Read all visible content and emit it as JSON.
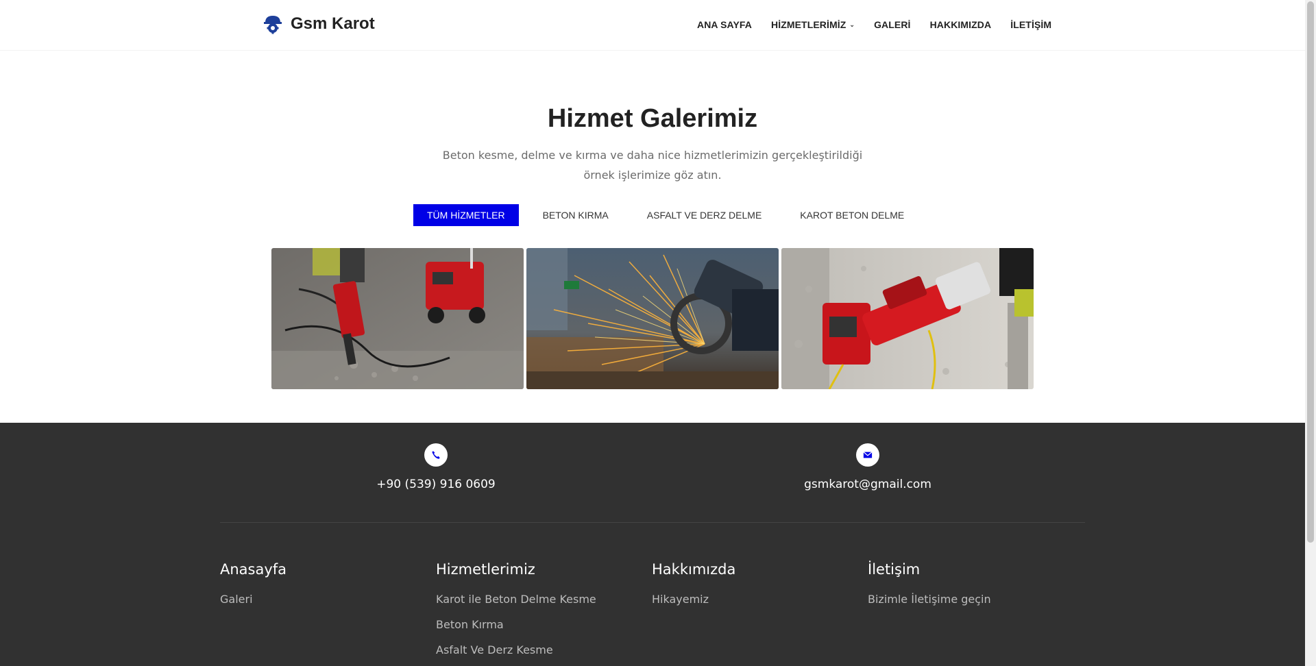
{
  "brand": {
    "name": "Gsm Karot",
    "accent": "#0000e6"
  },
  "nav": {
    "items": [
      {
        "label": "ANA SAYFA"
      },
      {
        "label": "HİZMETLERİMİZ"
      },
      {
        "label": "GALERİ"
      },
      {
        "label": "HAKKIMIZDA"
      },
      {
        "label": "İLETİŞİM"
      }
    ]
  },
  "gallery": {
    "title": "Hizmet Galerimiz",
    "subtitle": "Beton kesme, delme ve kırma ve daha nice hizmetlerimizin gerçekleştirildiği örnek işlerimize göz atın.",
    "filters": [
      {
        "label": "TÜM HİZMETLER",
        "active": true
      },
      {
        "label": "BETON KIRMA"
      },
      {
        "label": "ASFALT VE DERZ DELME"
      },
      {
        "label": "KAROT BETON DELME"
      }
    ]
  },
  "footer": {
    "phone": "+90 (539) 916 0609",
    "email": "gsmkarot@gmail.com",
    "columns": [
      {
        "title": "Anasayfa",
        "links": [
          "Galeri"
        ]
      },
      {
        "title": "Hizmetlerimiz",
        "links": [
          "Karot ile Beton Delme Kesme",
          "Beton Kırma",
          "Asfalt Ve Derz Kesme"
        ]
      },
      {
        "title": "Hakkımızda",
        "links": [
          "Hikayemiz"
        ]
      },
      {
        "title": "İletişim",
        "links": [
          "Bizimle İletişime geçin"
        ]
      }
    ]
  }
}
